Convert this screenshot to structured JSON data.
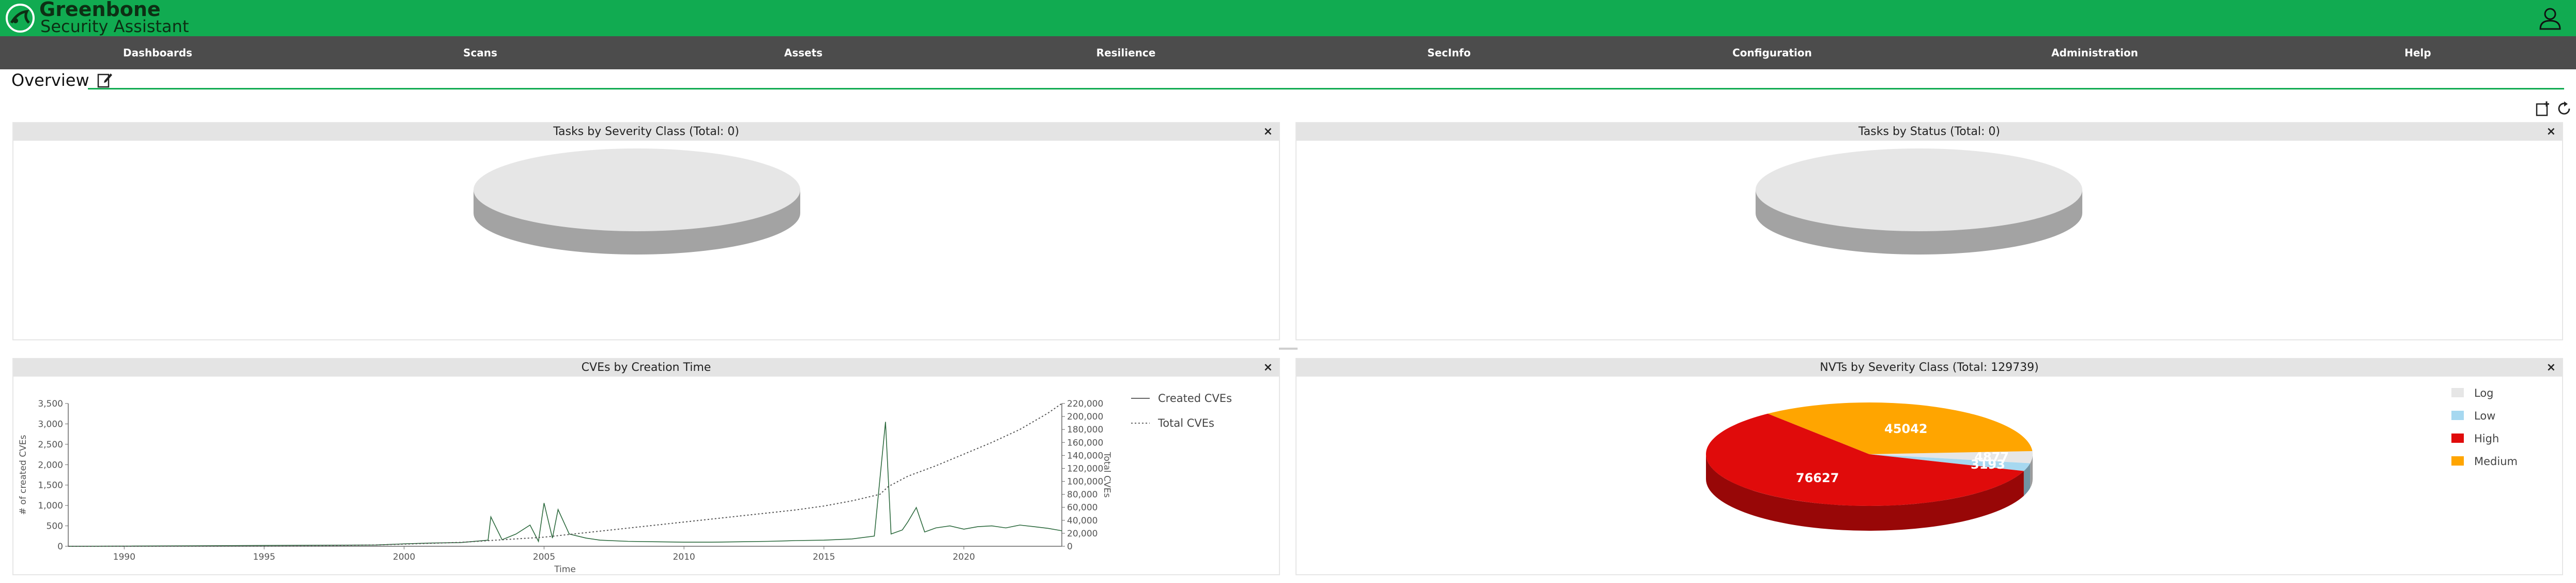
{
  "app": {
    "brand_line1": "Greenbone",
    "brand_line2": "Security Assistant"
  },
  "nav": {
    "items": [
      {
        "label": "Dashboards"
      },
      {
        "label": "Scans"
      },
      {
        "label": "Assets"
      },
      {
        "label": "Resilience"
      },
      {
        "label": "SecInfo"
      },
      {
        "label": "Configuration"
      },
      {
        "label": "Administration"
      },
      {
        "label": "Help"
      }
    ]
  },
  "page": {
    "title": "Overview"
  },
  "icons": {
    "logo": "greenbone-logo-icon",
    "user": "user-icon",
    "edit": "edit-dashboard-icon",
    "new_display": "new-dashboard-display-icon",
    "reset": "reset-dashboard-icon",
    "close": "close-icon"
  },
  "colors": {
    "brand": "#11ab51",
    "nav_bg": "#4c4c4c",
    "log": "#e6e6e6",
    "low": "#a6d8f0",
    "high": "#e00b0b",
    "medium": "#ffa500",
    "cve_line": "#2e6b3f"
  },
  "panels": {
    "tasks_severity": {
      "title": "Tasks by Severity Class (Total: 0)",
      "close": "×"
    },
    "tasks_status": {
      "title": "Tasks by Status (Total: 0)",
      "close": "×"
    },
    "cves_time": {
      "title": "CVEs by Creation Time",
      "close": "×"
    },
    "nvts_severity": {
      "title": "NVTs by Severity Class (Total: 129739)",
      "close": "×"
    }
  },
  "chart_data": [
    {
      "type": "pie",
      "title": "Tasks by Severity Class (Total: 0)",
      "categories": [],
      "values": []
    },
    {
      "type": "pie",
      "title": "Tasks by Status (Total: 0)",
      "categories": [],
      "values": []
    },
    {
      "type": "line",
      "title": "CVEs by Creation Time",
      "xlabel": "Time",
      "ylabel": "# of created CVEs",
      "y2label": "Total CVEs",
      "xlim": [
        1988,
        2023.5
      ],
      "ylim": [
        0,
        3500
      ],
      "y2lim": [
        0,
        220000
      ],
      "x_ticks": [
        "1990",
        "1995",
        "2000",
        "2005",
        "2010",
        "2015",
        "2020"
      ],
      "y_ticks": [
        "0",
        "500",
        "1,000",
        "1,500",
        "2,000",
        "2,500",
        "3,000",
        "3,500"
      ],
      "y2_ticks": [
        "0",
        "20,000",
        "40,000",
        "60,000",
        "80,000",
        "100,000",
        "120,000",
        "140,000",
        "160,000",
        "180,000",
        "200,000",
        "220,000"
      ],
      "legend": [
        "Created CVEs",
        "Total CVEs"
      ],
      "legend_position": "right",
      "series": [
        {
          "name": "Created CVEs",
          "style": "solid",
          "x": [
            1988,
            1999,
            2000,
            2001,
            2002,
            2003,
            2003.1,
            2003.5,
            2004,
            2004.5,
            2004.8,
            2005.0,
            2005.3,
            2005.5,
            2005.9,
            2006.5,
            2007,
            2008,
            2009,
            2010,
            2011,
            2012,
            2013,
            2014,
            2015,
            2016,
            2016.8,
            2017.2,
            2017.4,
            2017.8,
            2018,
            2018.3,
            2018.6,
            2019,
            2019.5,
            2020,
            2020.5,
            2021,
            2021.5,
            2022,
            2022.5,
            2023,
            2023.5
          ],
          "y": [
            0,
            30,
            60,
            80,
            90,
            150,
            720,
            160,
            300,
            520,
            120,
            1060,
            200,
            900,
            300,
            200,
            150,
            120,
            110,
            100,
            100,
            110,
            120,
            140,
            150,
            180,
            250,
            3050,
            300,
            400,
            600,
            950,
            350,
            450,
            500,
            420,
            480,
            500,
            450,
            520,
            480,
            440,
            380
          ]
        },
        {
          "name": "Total CVEs",
          "style": "dotted",
          "x": [
            1988,
            1995,
            1999,
            2002,
            2005,
            2008,
            2011,
            2014,
            2015,
            2016,
            2017,
            2017.3,
            2018,
            2019,
            2020,
            2021,
            2022,
            2023,
            2023.5
          ],
          "y": [
            0,
            300,
            2000,
            6000,
            14000,
            28000,
            42000,
            56000,
            62000,
            70000,
            80000,
            92000,
            108000,
            124000,
            142000,
            160000,
            180000,
            205000,
            220000
          ]
        }
      ]
    },
    {
      "type": "pie",
      "title": "NVTs by Severity Class (Total: 129739)",
      "categories": [
        "Log",
        "Low",
        "High",
        "Medium"
      ],
      "values": [
        4877,
        3193,
        76627,
        45042
      ],
      "value_labels": [
        "4877",
        "3193",
        "76627",
        "45042"
      ],
      "legend": [
        "Log",
        "Low",
        "High",
        "Medium"
      ],
      "legend_position": "right"
    }
  ]
}
